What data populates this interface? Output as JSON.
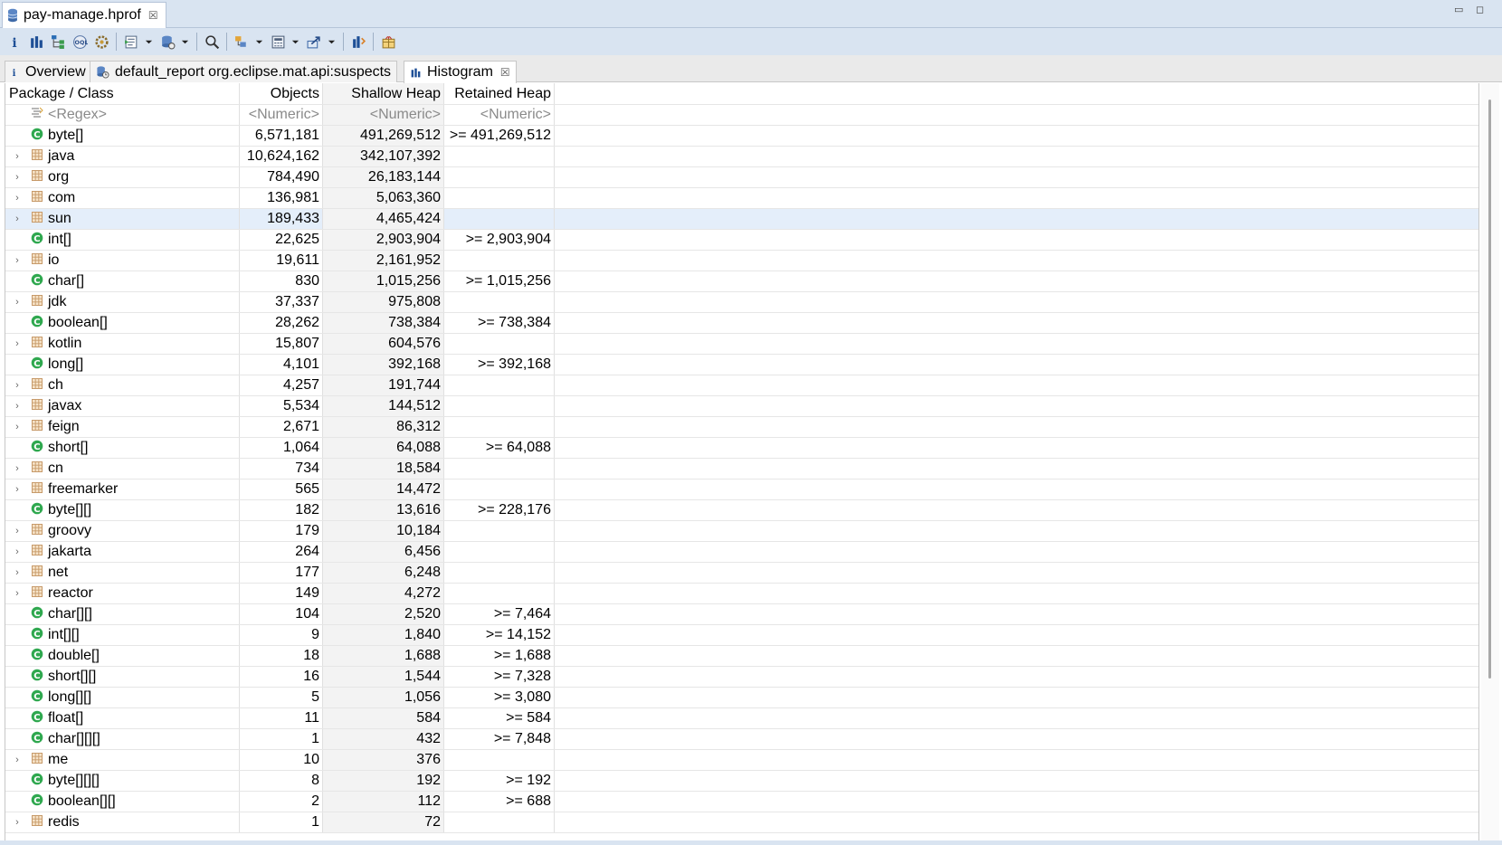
{
  "editor_tab": {
    "title": "pay-manage.hprof",
    "close": "☒"
  },
  "window_controls": {
    "minimize": "▭",
    "maximize": "◻"
  },
  "toolbar": {
    "items": [
      {
        "icon": "info-icon"
      },
      {
        "icon": "histogram-icon"
      },
      {
        "icon": "dominator-tree-icon"
      },
      {
        "icon": "oql-icon"
      },
      {
        "icon": "thread-overview-icon"
      },
      {
        "icon": "run-report-icon"
      },
      {
        "icon": "query-browser-icon"
      },
      {
        "icon": "search-icon"
      },
      {
        "icon": "group-by-icon"
      },
      {
        "icon": "calculator-icon"
      },
      {
        "icon": "export-icon"
      },
      {
        "icon": "compare-icon"
      },
      {
        "icon": "heap-dump-details-icon"
      }
    ]
  },
  "inner_tabs": [
    {
      "label": "Overview",
      "icon": "info-icon"
    },
    {
      "label": "default_report  org.eclipse.mat.api:suspects",
      "icon": "report-icon"
    },
    {
      "label": "Histogram",
      "icon": "histogram-icon",
      "close": "☒"
    }
  ],
  "table": {
    "columns": [
      "Package / Class",
      "Objects",
      "Shallow Heap",
      "Retained Heap"
    ],
    "filters": [
      "<Regex>",
      "<Numeric>",
      "<Numeric>",
      "<Numeric>"
    ],
    "rows": [
      {
        "name": "byte[]",
        "type": "class",
        "objects": "6,571,181",
        "shallow": "491,269,512",
        "retained": ">= 491,269,512"
      },
      {
        "name": "java",
        "type": "package",
        "objects": "10,624,162",
        "shallow": "342,107,392",
        "retained": ""
      },
      {
        "name": "org",
        "type": "package",
        "objects": "784,490",
        "shallow": "26,183,144",
        "retained": ""
      },
      {
        "name": "com",
        "type": "package",
        "objects": "136,981",
        "shallow": "5,063,360",
        "retained": ""
      },
      {
        "name": "sun",
        "type": "package",
        "objects": "189,433",
        "shallow": "4,465,424",
        "retained": "",
        "selected": true
      },
      {
        "name": "int[]",
        "type": "class",
        "objects": "22,625",
        "shallow": "2,903,904",
        "retained": ">= 2,903,904"
      },
      {
        "name": "io",
        "type": "package",
        "objects": "19,611",
        "shallow": "2,161,952",
        "retained": ""
      },
      {
        "name": "char[]",
        "type": "class",
        "objects": "830",
        "shallow": "1,015,256",
        "retained": ">= 1,015,256"
      },
      {
        "name": "jdk",
        "type": "package",
        "objects": "37,337",
        "shallow": "975,808",
        "retained": ""
      },
      {
        "name": "boolean[]",
        "type": "class",
        "objects": "28,262",
        "shallow": "738,384",
        "retained": ">= 738,384"
      },
      {
        "name": "kotlin",
        "type": "package",
        "objects": "15,807",
        "shallow": "604,576",
        "retained": ""
      },
      {
        "name": "long[]",
        "type": "class",
        "objects": "4,101",
        "shallow": "392,168",
        "retained": ">= 392,168"
      },
      {
        "name": "ch",
        "type": "package",
        "objects": "4,257",
        "shallow": "191,744",
        "retained": ""
      },
      {
        "name": "javax",
        "type": "package",
        "objects": "5,534",
        "shallow": "144,512",
        "retained": ""
      },
      {
        "name": "feign",
        "type": "package",
        "objects": "2,671",
        "shallow": "86,312",
        "retained": ""
      },
      {
        "name": "short[]",
        "type": "class",
        "objects": "1,064",
        "shallow": "64,088",
        "retained": ">= 64,088"
      },
      {
        "name": "cn",
        "type": "package",
        "objects": "734",
        "shallow": "18,584",
        "retained": ""
      },
      {
        "name": "freemarker",
        "type": "package",
        "objects": "565",
        "shallow": "14,472",
        "retained": ""
      },
      {
        "name": "byte[][]",
        "type": "class",
        "objects": "182",
        "shallow": "13,616",
        "retained": ">= 228,176"
      },
      {
        "name": "groovy",
        "type": "package",
        "objects": "179",
        "shallow": "10,184",
        "retained": ""
      },
      {
        "name": "jakarta",
        "type": "package",
        "objects": "264",
        "shallow": "6,456",
        "retained": ""
      },
      {
        "name": "net",
        "type": "package",
        "objects": "177",
        "shallow": "6,248",
        "retained": ""
      },
      {
        "name": "reactor",
        "type": "package",
        "objects": "149",
        "shallow": "4,272",
        "retained": ""
      },
      {
        "name": "char[][]",
        "type": "class",
        "objects": "104",
        "shallow": "2,520",
        "retained": ">= 7,464"
      },
      {
        "name": "int[][]",
        "type": "class",
        "objects": "9",
        "shallow": "1,840",
        "retained": ">= 14,152"
      },
      {
        "name": "double[]",
        "type": "class",
        "objects": "18",
        "shallow": "1,688",
        "retained": ">= 1,688"
      },
      {
        "name": "short[][]",
        "type": "class",
        "objects": "16",
        "shallow": "1,544",
        "retained": ">= 7,328"
      },
      {
        "name": "long[][]",
        "type": "class",
        "objects": "5",
        "shallow": "1,056",
        "retained": ">= 3,080"
      },
      {
        "name": "float[]",
        "type": "class",
        "objects": "11",
        "shallow": "584",
        "retained": ">= 584"
      },
      {
        "name": "char[][][]",
        "type": "class",
        "objects": "1",
        "shallow": "432",
        "retained": ">= 7,848"
      },
      {
        "name": "me",
        "type": "package",
        "objects": "10",
        "shallow": "376",
        "retained": ""
      },
      {
        "name": "byte[][][]",
        "type": "class",
        "objects": "8",
        "shallow": "192",
        "retained": ">= 192"
      },
      {
        "name": "boolean[][]",
        "type": "class",
        "objects": "2",
        "shallow": "112",
        "retained": ">= 688"
      },
      {
        "name": "redis",
        "type": "package",
        "objects": "1",
        "shallow": "72",
        "retained": ""
      }
    ]
  },
  "colors": {
    "class_icon": "#2fa84f",
    "package_icon": "#c79a6a",
    "selection": "#e4eefa",
    "chrome": "#d9e4f1"
  }
}
